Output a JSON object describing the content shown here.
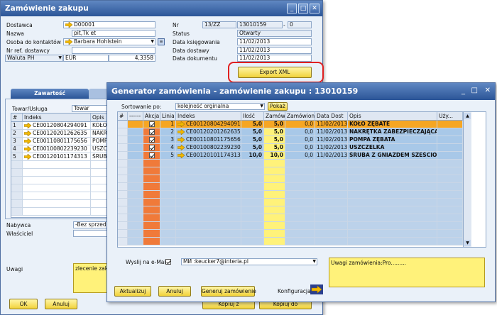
{
  "colors": {
    "title": "#2b5597",
    "accent_yellow": "#f1d23a",
    "highlight_red": "#e02020",
    "akcja_orange": "#f07a3a",
    "zamow_yellow": "#fff27a"
  },
  "back_window": {
    "title": "Zamówienie zakupu",
    "labels": {
      "dostawca": "Dostawca",
      "nazwa": "Nazwa",
      "osoba": "Osoba do kontaktów",
      "nr_ref": "Nr ref. dostawcy",
      "waluta": "Waluta PH",
      "nr": "Nr",
      "status": "Status",
      "data_ksiegowania": "Data księgowania",
      "data_dostawy": "Data dostawy",
      "data_dokumentu": "Data dokumentu"
    },
    "values": {
      "dostawca": "D00001",
      "nazwa": "pit,Tk et",
      "osoba": "Barbara Hohlstein",
      "nr_ref": "",
      "waluta_code": "EUR",
      "kurs": "4,3358",
      "nr_series": "13/ZZ",
      "nr_number": "13010159",
      "nr_suffix": "0",
      "status": "Otwarty",
      "data_ksiegowania": "11/02/2013",
      "data_dostawy": "11/02/2013",
      "data_dokumentu": "11/02/2013"
    },
    "export_button": "Export XML",
    "tab_label": "Zawartość",
    "towar_label": "Towar/Usługa",
    "towar_value": "Towar",
    "grid_headers": [
      "#",
      "Indeks",
      "Opis"
    ],
    "rows": [
      {
        "n": "1",
        "indeks": "CE00120804294091",
        "opis": "KOŁO"
      },
      {
        "n": "2",
        "indeks": "CE00120201262635",
        "opis": "NAKR"
      },
      {
        "n": "3",
        "indeks": "CE00110801175656",
        "opis": "POMP"
      },
      {
        "n": "4",
        "indeks": "CE00100802239230",
        "opis": "USZC"
      },
      {
        "n": "5",
        "indeks": "CE00120101174313",
        "opis": "ŚRUB"
      }
    ],
    "nabywca_label": "Nabywca",
    "nabywca_value": "-Bez sprzedaw",
    "wlasciciel_label": "Właściciel",
    "uwagi_label": "Uwagi",
    "uwagi_value": "zlecenie zakup",
    "ok_button": "OK",
    "anuluj_button": "Anuluj",
    "kopiuj_z_button": "Kopiuj z",
    "kopiuj_do_button": "Kopiuj do"
  },
  "generator": {
    "title": "Generator zamówienia - zamówienie zakupu : 13010159",
    "sort_label": "Sortowanie po:",
    "sort_value": "kolejność orginalna",
    "pokaz_button": "Pokaż",
    "headers": [
      "#",
      "------",
      "Akcja",
      "Linia",
      "Indeks",
      "Ilość",
      "Zamów",
      "Zamówiono",
      "Data Dost",
      "Opis",
      "Uży..."
    ],
    "rows": [
      {
        "linia": "1",
        "indeks": "CE00120804294091",
        "ilosc": "5,0",
        "zamow": "5,0",
        "zamowiono": "0,0",
        "data": "11/02/2013",
        "opis": "KOŁO ZĘBATE"
      },
      {
        "linia": "2",
        "indeks": "CE00120201262635",
        "ilosc": "5,0",
        "zamow": "5,0",
        "zamowiono": "0,0",
        "data": "11/02/2013",
        "opis": "NAKRĘTKA ZABEZPIECZAJĄCA"
      },
      {
        "linia": "3",
        "indeks": "CE00110801175656",
        "ilosc": "5,0",
        "zamow": "5,0",
        "zamowiono": "0,0",
        "data": "11/02/2013",
        "opis": "POMPA ZĘBATA"
      },
      {
        "linia": "4",
        "indeks": "CE00100802239230",
        "ilosc": "5,0",
        "zamow": "5,0",
        "zamowiono": "0,0",
        "data": "11/02/2013",
        "opis": "USZCZELKA"
      },
      {
        "linia": "5",
        "indeks": "CE00120101174313",
        "ilosc": "10,0",
        "zamow": "10,0",
        "zamowiono": "0,0",
        "data": "11/02/2013",
        "opis": "ŚRUBA Z GNIAZDEM SZEŚCIOKĄTNYM"
      }
    ],
    "email_label": "Wyslij na e-Mail",
    "email_value": "MИ :keucker7@interia.pl",
    "uwagi_value": "Uwagi zamówienia:Pro.........",
    "aktualizuj_button": "Aktualizuj",
    "anuluj_button": "Anuluj",
    "generuj_button": "Generuj zamówienie",
    "konfiguracja_label": "Konfiguracja"
  }
}
